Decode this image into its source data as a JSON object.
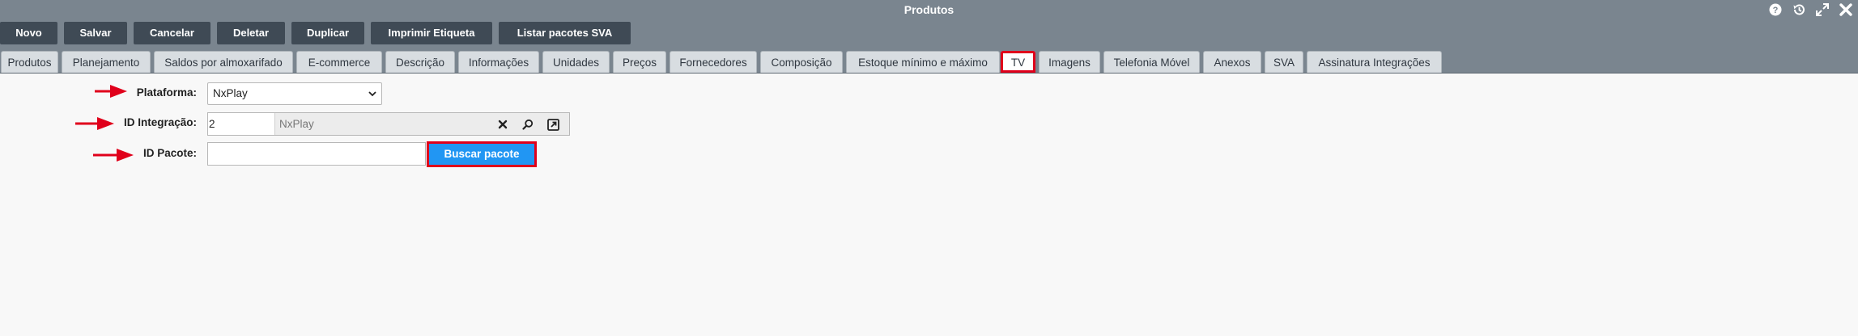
{
  "window": {
    "title": "Produtos"
  },
  "title_icons": [
    "help-icon",
    "history-icon",
    "expand-icon",
    "close-icon"
  ],
  "toolbar": {
    "buttons": [
      {
        "label": "Novo"
      },
      {
        "label": "Salvar"
      },
      {
        "label": "Cancelar"
      },
      {
        "label": "Deletar"
      },
      {
        "label": "Duplicar"
      },
      {
        "label": "Imprimir Etiqueta"
      },
      {
        "label": "Listar pacotes SVA"
      }
    ]
  },
  "tabs": [
    {
      "label": "Produtos"
    },
    {
      "label": "Planejamento"
    },
    {
      "label": "Saldos por almoxarifado"
    },
    {
      "label": "E-commerce"
    },
    {
      "label": "Descrição"
    },
    {
      "label": "Informações"
    },
    {
      "label": "Unidades"
    },
    {
      "label": "Preços"
    },
    {
      "label": "Fornecedores"
    },
    {
      "label": "Composição"
    },
    {
      "label": "Estoque mínimo e máximo"
    },
    {
      "label": "TV",
      "active": true
    },
    {
      "label": "Imagens"
    },
    {
      "label": "Telefonia Móvel"
    },
    {
      "label": "Anexos"
    },
    {
      "label": "SVA"
    },
    {
      "label": "Assinatura Integrações"
    }
  ],
  "form": {
    "plataforma": {
      "label": "Plataforma:",
      "value": "NxPlay"
    },
    "id_integracao": {
      "label": "ID Integração:",
      "id_value": "2",
      "description": "NxPlay"
    },
    "id_pacote": {
      "label": "ID Pacote:",
      "value": "",
      "button_label": "Buscar pacote"
    }
  },
  "colors": {
    "header_bg": "#7a858f",
    "button_bg": "#3f4a55",
    "highlight": "#e0001b",
    "primary_button": "#2196f3"
  }
}
